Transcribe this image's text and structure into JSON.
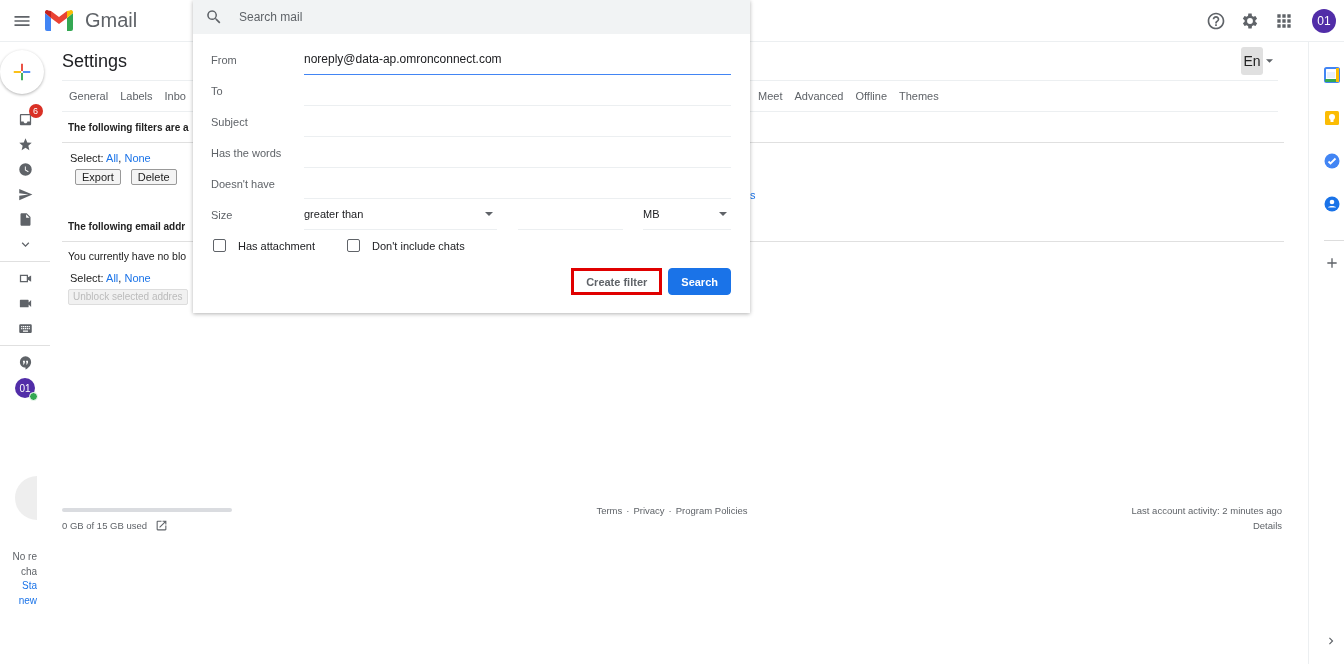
{
  "header": {
    "app_name": "Gmail",
    "search": {
      "placeholder": "Search mail"
    },
    "avatar": "01"
  },
  "left_rail": {
    "unread_badge": "6",
    "avatar": "01",
    "online": true,
    "chat_texts": [
      {
        "text": "No re",
        "kind": "plain"
      },
      {
        "text": "cha",
        "kind": "plain"
      },
      {
        "text": "Sta",
        "kind": "link"
      },
      {
        "text": "new",
        "kind": "link"
      }
    ]
  },
  "settings": {
    "title": "Settings",
    "language": "En",
    "tabs_left": [
      "General",
      "Labels",
      "Inbo"
    ],
    "tabs_right": [
      "Meet",
      "Advanced",
      "Offline",
      "Themes"
    ],
    "filters": {
      "heading": "The following filters are a",
      "select_label": "Select:",
      "select_all": "All",
      "select_separator": ",",
      "select_none": "None",
      "buttons": [
        "Export",
        "Delete"
      ],
      "link": "s"
    },
    "blocked": {
      "heading": "The following email addr",
      "message": "You currently have no blo",
      "select_label": "Select:",
      "select_all": "All",
      "select_separator": ",",
      "select_none": "None",
      "button": {
        "label": "Unblock selected addres",
        "disabled": true
      }
    }
  },
  "filter_dialog": {
    "fields": [
      {
        "label": "From",
        "value": "noreply@data-ap.omronconnect.com",
        "focused": true
      },
      {
        "label": "To",
        "focused": false
      },
      {
        "label": "Subject",
        "focused": false
      },
      {
        "label": "Has the words",
        "focused": false
      },
      {
        "label": "Doesn't have",
        "focused": false
      }
    ],
    "size": {
      "label": "Size",
      "comparison": "greater than",
      "unit": "MB"
    },
    "checkboxes": [
      {
        "label": "Has attachment",
        "checked": false
      },
      {
        "label": "Don't include chats",
        "checked": false
      }
    ],
    "buttons": [
      {
        "label": "Create filter",
        "kind": "secondary",
        "highlighted": true
      },
      {
        "label": "Search",
        "kind": "primary",
        "highlighted": false
      }
    ]
  },
  "footer": {
    "storage": {
      "text": "0 GB of 15 GB used"
    },
    "links": [
      "Terms",
      "Privacy",
      "Program Policies"
    ],
    "separator": "·",
    "activity": "Last account activity: 2 minutes ago",
    "details": "Details"
  }
}
